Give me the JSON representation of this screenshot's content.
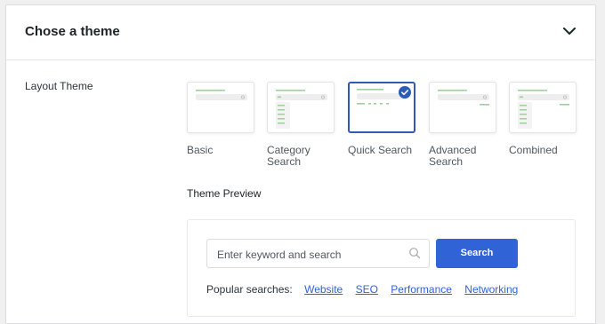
{
  "panel": {
    "title": "Chose a theme"
  },
  "layout_theme": {
    "label": "Layout Theme",
    "options": [
      {
        "name": "Basic",
        "selected": false
      },
      {
        "name_line1": "Category",
        "name_line2": "Search",
        "selected": false
      },
      {
        "name": "Quick Search",
        "selected": true
      },
      {
        "name_line1": "Advanced",
        "name_line2": "Search",
        "selected": false
      },
      {
        "name": "Combined",
        "selected": false
      }
    ]
  },
  "preview": {
    "label": "Theme Preview",
    "search_placeholder": "Enter keyword and search",
    "search_button": "Search",
    "popular_label": "Popular searches:",
    "popular_links": [
      "Website",
      "SEO",
      "Performance",
      "Networking"
    ]
  },
  "colors": {
    "accent": "#2f63d6",
    "selected_border": "#2c5bb8",
    "thumb_green": "#9fcf9f",
    "thumb_gray": "#eeeeee"
  },
  "icons": {
    "collapse": "chevron-down-icon",
    "search": "search-icon",
    "selected": "check-icon"
  }
}
